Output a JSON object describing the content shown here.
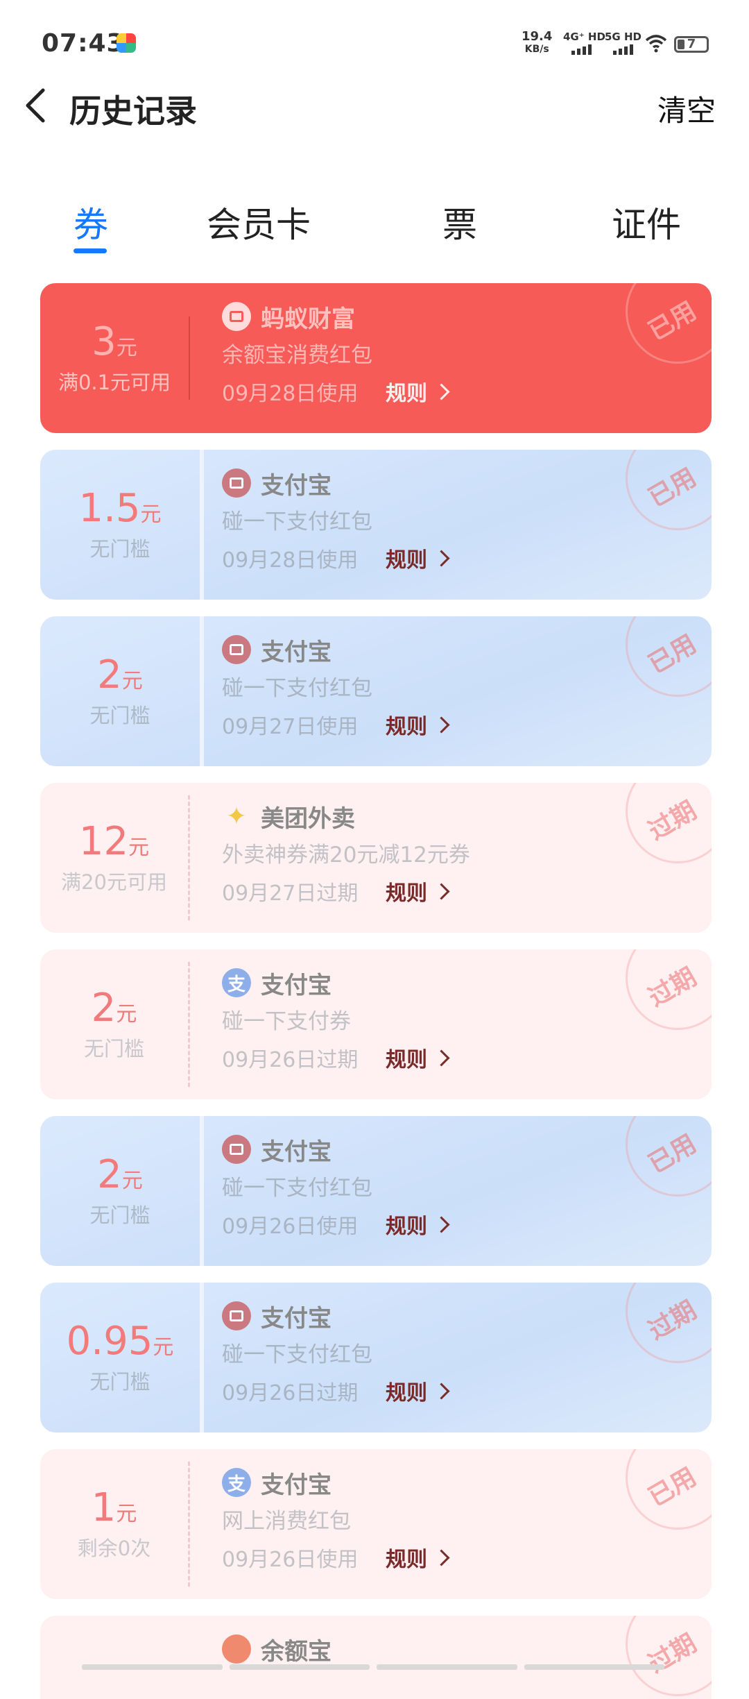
{
  "status_bar": {
    "time": "07:43",
    "net_speed_value": "19.4",
    "net_speed_unit": "KB/s",
    "sim1": "4G⁺ HD",
    "sim2": "5G HD",
    "battery": "7"
  },
  "header": {
    "title": "历史记录",
    "clear_label": "清空"
  },
  "tabs": [
    {
      "label": "券",
      "active": true
    },
    {
      "label": "会员卡",
      "active": false
    },
    {
      "label": "票",
      "active": false
    },
    {
      "label": "证件",
      "active": false
    }
  ],
  "rule_label": "规则",
  "coupons": [
    {
      "style": "red",
      "amount": "3",
      "unit": "元",
      "condition": "满0.1元可用",
      "merchant": "蚂蚁财富",
      "icon": "red-packet-icon",
      "description": "余额宝消费红包",
      "date": "09月28日使用",
      "stamp": "已用"
    },
    {
      "style": "blue",
      "amount": "1.5",
      "unit": "元",
      "condition": "无门槛",
      "merchant": "支付宝",
      "icon": "red-packet-icon",
      "description": "碰一下支付红包",
      "date": "09月28日使用",
      "stamp": "已用"
    },
    {
      "style": "blue",
      "amount": "2",
      "unit": "元",
      "condition": "无门槛",
      "merchant": "支付宝",
      "icon": "red-packet-icon",
      "description": "碰一下支付红包",
      "date": "09月27日使用",
      "stamp": "已用"
    },
    {
      "style": "pink",
      "amount": "12",
      "unit": "元",
      "condition": "满20元可用",
      "merchant": "美团外卖",
      "icon": "meituan-kangaroo-icon",
      "description": "外卖神券满20元减12元券",
      "date": "09月27日过期",
      "stamp": "过期"
    },
    {
      "style": "pink",
      "amount": "2",
      "unit": "元",
      "condition": "无门槛",
      "merchant": "支付宝",
      "icon": "alipay-icon",
      "description": "碰一下支付券",
      "date": "09月26日过期",
      "stamp": "过期"
    },
    {
      "style": "blue",
      "amount": "2",
      "unit": "元",
      "condition": "无门槛",
      "merchant": "支付宝",
      "icon": "red-packet-icon",
      "description": "碰一下支付红包",
      "date": "09月26日使用",
      "stamp": "已用"
    },
    {
      "style": "blue",
      "amount": "0.95",
      "unit": "元",
      "condition": "无门槛",
      "merchant": "支付宝",
      "icon": "red-packet-icon",
      "description": "碰一下支付红包",
      "date": "09月26日过期",
      "stamp": "过期"
    },
    {
      "style": "pink",
      "amount": "1",
      "unit": "元",
      "condition": "剩余0次",
      "merchant": "支付宝",
      "icon": "alipay-icon",
      "description": "网上消费红包",
      "date": "09月26日使用",
      "stamp": "已用"
    }
  ],
  "partial_coupon": {
    "merchant": "余额宝",
    "icon": "yuebao-icon",
    "stamp": "过期"
  }
}
